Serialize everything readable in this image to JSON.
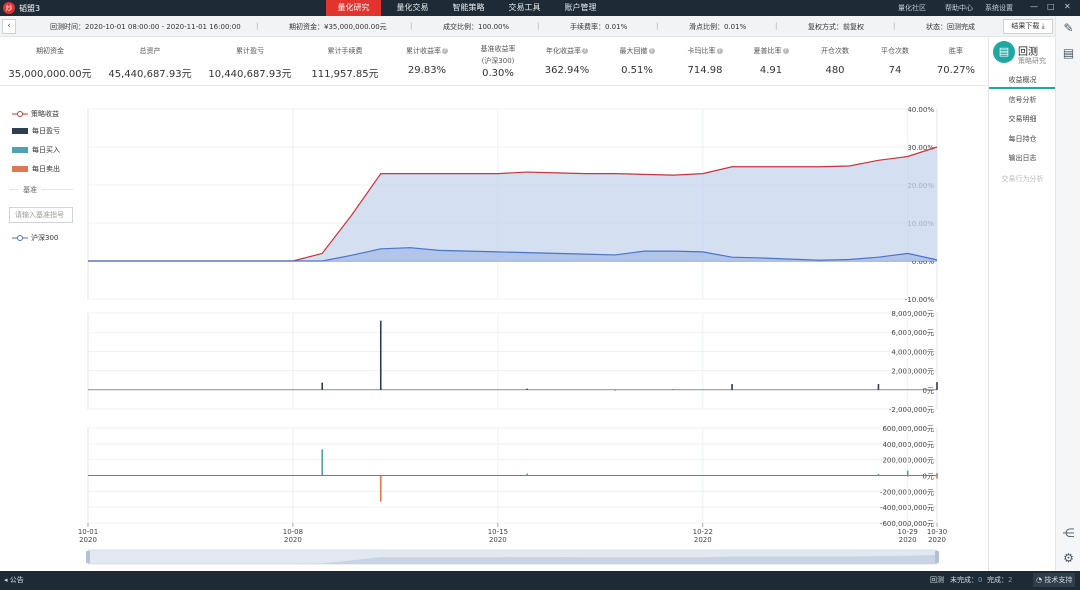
{
  "app": {
    "logo_glyph": "炒",
    "name": "韬盟3"
  },
  "nav": {
    "tabs": [
      {
        "label": "量化研究",
        "active": true
      },
      {
        "label": "量化交易",
        "active": false
      },
      {
        "label": "智能策略",
        "active": false
      },
      {
        "label": "交易工具",
        "active": false
      },
      {
        "label": "账户管理",
        "active": false
      }
    ],
    "links": {
      "community": "量化社区",
      "help": "帮助中心",
      "settings": "系统设置"
    },
    "window_controls": {
      "minimize": "—",
      "maximize": "□",
      "close": "✕"
    }
  },
  "infobar": {
    "back_icon": "‹",
    "backtest_time": "回测时间：2020-10-01 08:00:00 - 2020-11-01 16:00:00",
    "initial_capital": "期初资金：¥35,000,000.00元",
    "fill_ratio": "成交比例：100.00%",
    "fee_rate": "手续费率：0.01%",
    "slippage": "滑点比例：0.01%",
    "adjust": "复权方式：前复权",
    "status": "状态：回测完成",
    "download": "结果下载 ⤓"
  },
  "stats": [
    {
      "label": "期初资金",
      "value": "35,000,000.00元"
    },
    {
      "label": "总资产",
      "value": "45,440,687.93元"
    },
    {
      "label": "累计盈亏",
      "value": "10,440,687.93元"
    },
    {
      "label": "累计手续费",
      "value": "111,957.85元"
    },
    {
      "label": "累计收益率",
      "value": "29.83%",
      "info": true
    },
    {
      "label": "基准收益率",
      "sublabel": "(沪深300)",
      "value": "0.30%"
    },
    {
      "label": "年化收益率",
      "value": "362.94%",
      "info": true
    },
    {
      "label": "最大回撤",
      "value": "0.51%",
      "info": true
    },
    {
      "label": "卡玛比率",
      "value": "714.98",
      "info": true
    },
    {
      "label": "夏普比率",
      "value": "4.91",
      "info": true
    },
    {
      "label": "开仓次数",
      "value": "480"
    },
    {
      "label": "平仓次数",
      "value": "74"
    },
    {
      "label": "胜率",
      "value": "70.27%"
    }
  ],
  "side": {
    "icon": "▤",
    "title": "回测",
    "subtitle": "策略研究",
    "menu": [
      {
        "label": "收益概况",
        "active": true,
        "disabled": false
      },
      {
        "label": "信号分析",
        "active": false,
        "disabled": false
      },
      {
        "label": "交易明细",
        "active": false,
        "disabled": false
      },
      {
        "label": "每日持仓",
        "active": false,
        "disabled": false
      },
      {
        "label": "输出日志",
        "active": false,
        "disabled": false
      },
      {
        "label": "交易行为分析",
        "active": false,
        "disabled": true
      }
    ]
  },
  "rightbar": {
    "icons": [
      "edit-icon",
      "doc-icon",
      "share-icon",
      "gear-icon"
    ]
  },
  "legend": {
    "strategy": "策略收益",
    "daily_pnl": "每日盈亏",
    "daily_buy": "每日买入",
    "daily_sell": "每日卖出",
    "benchmark_title": "基准",
    "benchmark_placeholder": "请输入基准指号",
    "benchmark": "沪深300"
  },
  "colors": {
    "strategy": "#c9353b",
    "benchmark": "#4a74c9",
    "area": "#c7d4ee",
    "pnl": "#2c3e50",
    "buy": "#4ea1b0",
    "sell": "#e0774e"
  },
  "chart_data": [
    {
      "type": "area",
      "title": "",
      "x": [
        "10-01",
        "10-02",
        "10-03",
        "10-04",
        "10-05",
        "10-06",
        "10-07",
        "10-08",
        "10-09",
        "10-10",
        "10-11",
        "10-12",
        "10-13",
        "10-14",
        "10-15",
        "10-16",
        "10-17",
        "10-18",
        "10-19",
        "10-20",
        "10-21",
        "10-22",
        "10-23",
        "10-24",
        "10-25",
        "10-26",
        "10-27",
        "10-28",
        "10-29",
        "10-30"
      ],
      "series": [
        {
          "name": "策略收益",
          "values": [
            0,
            0,
            0,
            0,
            0,
            0,
            0,
            0,
            2,
            12,
            23,
            23,
            23,
            23,
            23,
            23.4,
            23.2,
            23,
            23,
            22.8,
            22.6,
            23,
            24.8,
            24.8,
            24.8,
            24.8,
            25,
            26.5,
            27.5,
            30
          ]
        },
        {
          "name": "沪深300",
          "values": [
            0,
            0,
            0,
            0,
            0,
            0,
            0,
            0,
            0,
            1.5,
            3.2,
            3.5,
            2.8,
            2.6,
            2.4,
            2.2,
            2,
            1.8,
            1.6,
            2.6,
            2.6,
            2.4,
            1,
            0.8,
            0.5,
            0.2,
            0.4,
            1,
            2,
            0.3
          ]
        }
      ],
      "ylim": [
        -10,
        40
      ],
      "yticks": [
        "40.00%",
        "30.00%",
        "20.00%",
        "10.00%",
        "0.00%",
        "-10.00%"
      ]
    },
    {
      "type": "bar",
      "title": "",
      "x": [
        "10-01",
        "10-02",
        "10-03",
        "10-04",
        "10-05",
        "10-06",
        "10-07",
        "10-08",
        "10-09",
        "10-10",
        "10-11",
        "10-12",
        "10-13",
        "10-14",
        "10-15",
        "10-16",
        "10-17",
        "10-18",
        "10-19",
        "10-20",
        "10-21",
        "10-22",
        "10-23",
        "10-24",
        "10-25",
        "10-26",
        "10-27",
        "10-28",
        "10-29",
        "10-30"
      ],
      "series": [
        {
          "name": "每日盈亏",
          "values": [
            0,
            0,
            0,
            0,
            0,
            0,
            0,
            0,
            750000,
            0,
            7200000,
            0,
            0,
            0,
            0,
            120000,
            0,
            0,
            -60000,
            0,
            50000,
            0,
            600000,
            0,
            0,
            0,
            0,
            600000,
            0,
            800000
          ]
        }
      ],
      "ylim": [
        -2000000,
        8000000
      ],
      "yticks": [
        "8,000,000元",
        "6,000,000元",
        "4,000,000元",
        "2,000,000元",
        "0元",
        "-2,000,000元"
      ]
    },
    {
      "type": "bar",
      "title": "",
      "x": [
        "10-01",
        "10-02",
        "10-03",
        "10-04",
        "10-05",
        "10-06",
        "10-07",
        "10-08",
        "10-09",
        "10-10",
        "10-11",
        "10-12",
        "10-13",
        "10-14",
        "10-15",
        "10-16",
        "10-17",
        "10-18",
        "10-19",
        "10-20",
        "10-21",
        "10-22",
        "10-23",
        "10-24",
        "10-25",
        "10-26",
        "10-27",
        "10-28",
        "10-29",
        "10-30"
      ],
      "series": [
        {
          "name": "每日买入",
          "values": [
            0,
            0,
            0,
            0,
            0,
            0,
            0,
            0,
            330000000,
            0,
            0,
            0,
            0,
            0,
            0,
            25000000,
            0,
            0,
            0,
            0,
            0,
            0,
            0,
            0,
            0,
            0,
            0,
            20000000,
            60000000,
            30000000
          ]
        },
        {
          "name": "每日卖出",
          "values": [
            0,
            0,
            0,
            0,
            0,
            0,
            0,
            0,
            0,
            0,
            -330000000,
            0,
            0,
            0,
            0,
            0,
            0,
            0,
            0,
            0,
            0,
            0,
            0,
            0,
            0,
            0,
            0,
            0,
            -15000000,
            -40000000
          ]
        }
      ],
      "ylim": [
        -600000000,
        600000000
      ],
      "yticks": [
        "600,000,000元",
        "400,000,000元",
        "200,000,000元",
        "0元",
        "-200,000,000元",
        "-400,000,000元",
        "-600,000,000元"
      ]
    }
  ],
  "xaxis": [
    {
      "label": "10-01",
      "year": "2020"
    },
    {
      "label": "10-08",
      "year": "2020"
    },
    {
      "label": "10-15",
      "year": "2020"
    },
    {
      "label": "10-22",
      "year": "2020"
    },
    {
      "label": "10-29",
      "year": "2020"
    },
    {
      "label": "10-30",
      "year": "2020"
    }
  ],
  "statusbar": {
    "announce": "公告",
    "backtest": "回测",
    "pending": "未完成：",
    "pending_count": "0",
    "done": "完成：",
    "done_count": "2",
    "support": "技术支持"
  }
}
